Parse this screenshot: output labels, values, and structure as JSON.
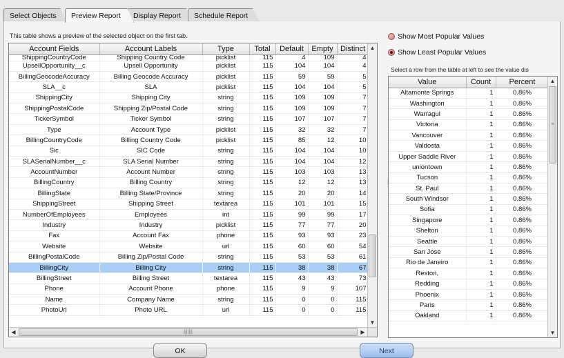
{
  "tabs": [
    {
      "label": "Select Objects"
    },
    {
      "label": "Preview Report"
    },
    {
      "label": "Display Report"
    },
    {
      "label": "Schedule Report"
    }
  ],
  "active_tab": "Preview Report",
  "description": "This table shows a preview of the selected object on the first tab.",
  "left_table": {
    "columns": [
      "Account Fields",
      "Account Labels",
      "Type",
      "Total",
      "Default",
      "Empty",
      "Distinct"
    ],
    "rows": [
      [
        "ShippingCountryCode",
        "Shipping Country Code",
        "picklist",
        "115",
        "4",
        "109",
        "4"
      ],
      [
        "UpsellOpportunity__c",
        "Upsell Opportunity",
        "picklist",
        "115",
        "104",
        "104",
        "4"
      ],
      [
        "BillingGeocodeAccuracy",
        "Billing Geocode Accuracy",
        "picklist",
        "115",
        "59",
        "59",
        "5"
      ],
      [
        "SLA__c",
        "SLA",
        "picklist",
        "115",
        "104",
        "104",
        "5"
      ],
      [
        "ShippingCity",
        "Shipping City",
        "string",
        "115",
        "109",
        "109",
        "7"
      ],
      [
        "ShippingPostalCode",
        "Shipping Zip/Postal Code",
        "string",
        "115",
        "109",
        "109",
        "7"
      ],
      [
        "TickerSymbol",
        "Ticker Symbol",
        "string",
        "115",
        "107",
        "107",
        "7"
      ],
      [
        "Type",
        "Account Type",
        "picklist",
        "115",
        "32",
        "32",
        "7"
      ],
      [
        "BillingCountryCode",
        "Billing Country Code",
        "picklist",
        "115",
        "85",
        "12",
        "10"
      ],
      [
        "Sic",
        "SIC Code",
        "string",
        "115",
        "104",
        "104",
        "10"
      ],
      [
        "SLASerialNumber__c",
        "SLA Serial Number",
        "string",
        "115",
        "104",
        "104",
        "12"
      ],
      [
        "AccountNumber",
        "Account Number",
        "string",
        "115",
        "103",
        "103",
        "13"
      ],
      [
        "BillingCountry",
        "Billing Country",
        "string",
        "115",
        "12",
        "12",
        "13"
      ],
      [
        "BillingState",
        "Billing State/Province",
        "string",
        "115",
        "20",
        "20",
        "14"
      ],
      [
        "ShippingStreet",
        "Shipping Street",
        "textarea",
        "115",
        "101",
        "101",
        "15"
      ],
      [
        "NumberOfEmployees",
        "Employees",
        "int",
        "115",
        "99",
        "99",
        "17"
      ],
      [
        "Industry",
        "Industry",
        "picklist",
        "115",
        "77",
        "77",
        "20"
      ],
      [
        "Fax",
        "Account Fax",
        "phone",
        "115",
        "93",
        "93",
        "23"
      ],
      [
        "Website",
        "Website",
        "url",
        "115",
        "60",
        "60",
        "54"
      ],
      [
        "BillingPostalCode",
        "Billing Zip/Postal Code",
        "string",
        "115",
        "53",
        "53",
        "61"
      ],
      [
        "BillingCity",
        "Billing City",
        "string",
        "115",
        "38",
        "38",
        "67"
      ],
      [
        "BillingStreet",
        "Billing Street",
        "textarea",
        "115",
        "43",
        "43",
        "73"
      ],
      [
        "Phone",
        "Account Phone",
        "phone",
        "115",
        "9",
        "9",
        "107"
      ],
      [
        "Name",
        "Company Name",
        "string",
        "115",
        "0",
        "0",
        "115"
      ],
      [
        "PhotoUrl",
        "Photo URL",
        "url",
        "115",
        "0",
        "0",
        "115"
      ]
    ],
    "selected_row": "BillingCity"
  },
  "radio_options": [
    {
      "label": "Show Most Popular Values",
      "selected": false
    },
    {
      "label": "Show Least Popular Values",
      "selected": true
    }
  ],
  "hint": "Select a row from the table at left to see the value dis",
  "right_table": {
    "columns": [
      "Value",
      "Count",
      "Percent"
    ],
    "rows": [
      [
        "Altamonte Springs",
        "1",
        "0.86%"
      ],
      [
        "Washington",
        "1",
        "0.86%"
      ],
      [
        "Warragul",
        "1",
        "0.86%"
      ],
      [
        "Victoria",
        "1",
        "0.86%"
      ],
      [
        "Vancouver",
        "1",
        "0.86%"
      ],
      [
        "Valdosta",
        "1",
        "0.86%"
      ],
      [
        "Upper Saddle River",
        "1",
        "0.86%"
      ],
      [
        "uniontown",
        "1",
        "0.86%"
      ],
      [
        "Tucson",
        "1",
        "0.86%"
      ],
      [
        "St. Paul",
        "1",
        "0.86%"
      ],
      [
        "South Windsor",
        "1",
        "0.86%"
      ],
      [
        "Sofia",
        "1",
        "0.86%"
      ],
      [
        "Singapore",
        "1",
        "0.86%"
      ],
      [
        "Shelton",
        "1",
        "0.86%"
      ],
      [
        "Seattle",
        "1",
        "0.86%"
      ],
      [
        "San Jose",
        "1",
        "0.86%"
      ],
      [
        "Rio de Janeiro",
        "1",
        "0.86%"
      ],
      [
        "Reston,",
        "1",
        "0.86%"
      ],
      [
        "Redding",
        "1",
        "0.86%"
      ],
      [
        "Phoenix",
        "1",
        "0.86%"
      ],
      [
        "Paris",
        "1",
        "0.86%"
      ],
      [
        "Oakland",
        "1",
        "0.86%"
      ]
    ]
  },
  "buttons": {
    "ok": "OK",
    "next": "Next"
  },
  "icons": {
    "scroll_up": "triangle-up-icon",
    "scroll_down": "triangle-down-icon",
    "scroll_left": "triangle-left-icon",
    "scroll_right": "triangle-right-icon",
    "splitter": "splitter-grip-icon",
    "grip": "scroll-grip-icon"
  },
  "colors": {
    "selected_row": "#a9cdf3",
    "radio": "#c77d7d",
    "next_button": "#9dbde9"
  }
}
